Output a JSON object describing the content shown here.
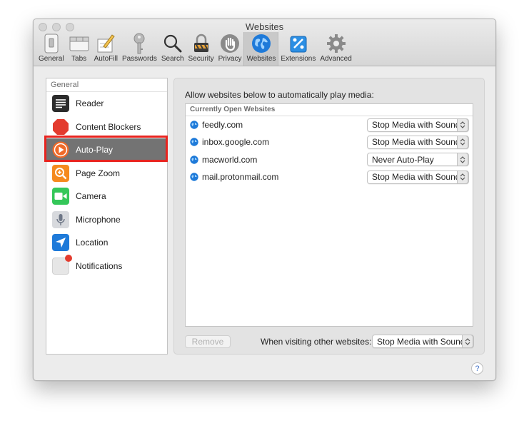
{
  "window": {
    "title": "Websites"
  },
  "toolbar": {
    "items": [
      {
        "label": "General",
        "icon": "general-switch-icon"
      },
      {
        "label": "Tabs",
        "icon": "tabs-icon"
      },
      {
        "label": "AutoFill",
        "icon": "pencil-form-icon"
      },
      {
        "label": "Passwords",
        "icon": "key-icon"
      },
      {
        "label": "Search",
        "icon": "magnifier-icon"
      },
      {
        "label": "Security",
        "icon": "padlock-icon"
      },
      {
        "label": "Privacy",
        "icon": "hand-icon"
      },
      {
        "label": "Websites",
        "icon": "globe-icon",
        "selected": true
      },
      {
        "label": "Extensions",
        "icon": "puzzle-icon"
      },
      {
        "label": "Advanced",
        "icon": "gear-icon"
      }
    ]
  },
  "sidebar": {
    "heading": "General",
    "items": [
      {
        "label": "Reader",
        "icon": "reader-icon"
      },
      {
        "label": "Content Blockers",
        "icon": "stop-sign-icon"
      },
      {
        "label": "Auto-Play",
        "icon": "play-icon",
        "selected": true
      },
      {
        "label": "Page Zoom",
        "icon": "zoom-icon"
      },
      {
        "label": "Camera",
        "icon": "camera-icon"
      },
      {
        "label": "Microphone",
        "icon": "microphone-icon"
      },
      {
        "label": "Location",
        "icon": "location-arrow-icon"
      },
      {
        "label": "Notifications",
        "icon": "notification-icon"
      }
    ]
  },
  "main": {
    "description": "Allow websites below to automatically play media:",
    "table_header": "Currently Open Websites",
    "sites": [
      {
        "name": "feedly.com",
        "setting": "Stop Media with Sound"
      },
      {
        "name": "inbox.google.com",
        "setting": "Stop Media with Sound"
      },
      {
        "name": "macworld.com",
        "setting": "Never Auto-Play"
      },
      {
        "name": "mail.protonmail.com",
        "setting": "Stop Media with Sound"
      }
    ],
    "remove_label": "Remove",
    "other_label": "When visiting other websites:",
    "other_setting": "Stop Media with Sound",
    "help_label": "?"
  },
  "colors": {
    "selection": "#737373",
    "highlight_border": "#e8241f",
    "accent_blue": "#1e7ad9"
  }
}
